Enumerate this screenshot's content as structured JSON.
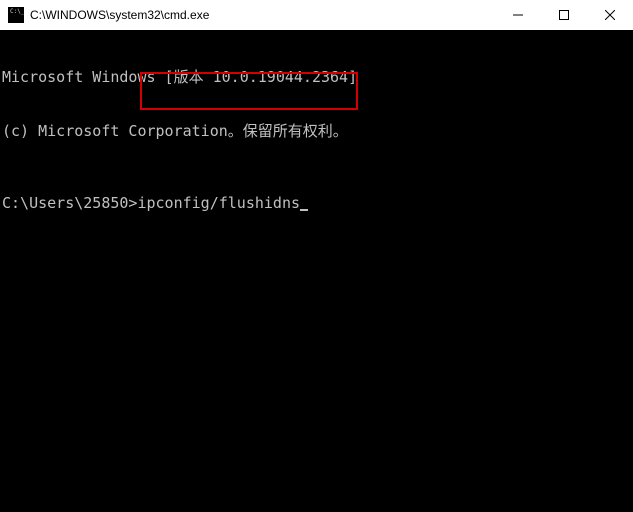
{
  "window": {
    "title": "C:\\WINDOWS\\system32\\cmd.exe"
  },
  "terminal": {
    "line1": "Microsoft Windows [版本 10.0.19044.2364]",
    "line2": "(c) Microsoft Corporation。保留所有权利。",
    "prompt": "C:\\Users\\25850>",
    "command": "ipconfig/flushidns"
  },
  "icons": {
    "minimize": "minimize",
    "maximize": "maximize",
    "close": "close",
    "app": "cmd-icon"
  }
}
